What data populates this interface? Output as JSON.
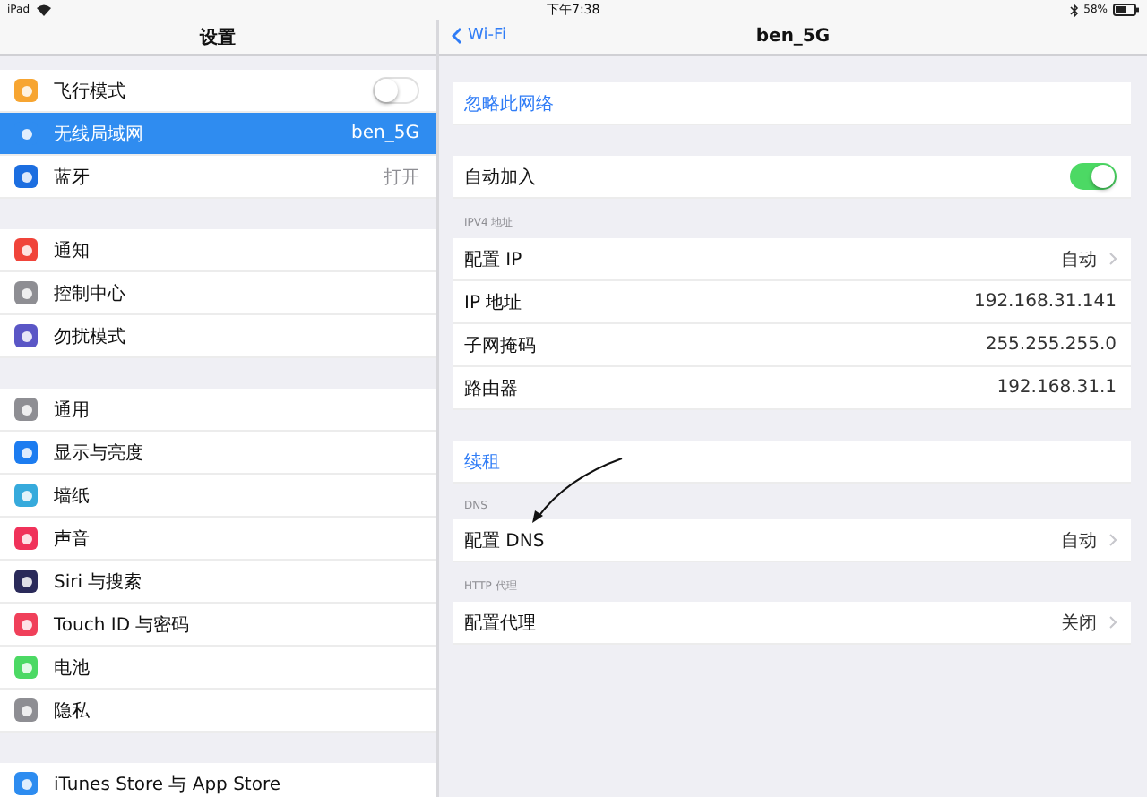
{
  "status_bar": {
    "device": "iPad",
    "time": "下午7:38",
    "battery": "58%"
  },
  "sidebar": {
    "title": "设置",
    "groups": [
      [
        {
          "label": "飞行模式",
          "kind": "toggle",
          "on": false,
          "selected": false,
          "color": "#f7a531"
        },
        {
          "label": "无线局域网",
          "kind": "value",
          "value": "ben_5G",
          "selected": true,
          "color": "#2f8cf0"
        },
        {
          "label": "蓝牙",
          "kind": "value",
          "value": "打开",
          "selected": false,
          "color": "#1c6ee0"
        }
      ],
      [
        {
          "label": "通知",
          "kind": "plain",
          "selected": false,
          "color": "#f0443a"
        },
        {
          "label": "控制中心",
          "kind": "plain",
          "selected": false,
          "color": "#8e8e93"
        },
        {
          "label": "勿扰模式",
          "kind": "plain",
          "selected": false,
          "color": "#5a56c6"
        }
      ],
      [
        {
          "label": "通用",
          "kind": "plain",
          "selected": false,
          "color": "#8e8e93"
        },
        {
          "label": "显示与亮度",
          "kind": "plain",
          "selected": false,
          "color": "#1c7cf0"
        },
        {
          "label": "墙纸",
          "kind": "plain",
          "selected": false,
          "color": "#36aadc"
        },
        {
          "label": "声音",
          "kind": "plain",
          "selected": false,
          "color": "#f0325a"
        },
        {
          "label": "Siri 与搜索",
          "kind": "plain",
          "selected": false,
          "color": "#2a2a5a"
        },
        {
          "label": "Touch ID 与密码",
          "kind": "plain",
          "selected": false,
          "color": "#f0405a"
        },
        {
          "label": "电池",
          "kind": "plain",
          "selected": false,
          "color": "#4cd964"
        },
        {
          "label": "隐私",
          "kind": "plain",
          "selected": false,
          "color": "#8e8e93"
        }
      ],
      [
        {
          "label": "iTunes Store 与 App Store",
          "kind": "plain",
          "selected": false,
          "color": "#2d8cf0"
        }
      ]
    ]
  },
  "detail": {
    "back": "Wi-Fi",
    "title": "ben_5G",
    "sections": [
      {
        "rows": [
          {
            "label": "忽略此网络",
            "kind": "link"
          }
        ]
      },
      {
        "rows": [
          {
            "label": "自动加入",
            "kind": "toggle",
            "on": true
          }
        ]
      },
      {
        "header": "IPV4 地址",
        "rows": [
          {
            "label": "配置 IP",
            "kind": "detail",
            "value": "自动"
          },
          {
            "label": "IP 地址",
            "kind": "info",
            "value": "192.168.31.141"
          },
          {
            "label": "子网掩码",
            "kind": "info",
            "value": "255.255.255.0"
          },
          {
            "label": "路由器",
            "kind": "info",
            "value": "192.168.31.1"
          }
        ]
      },
      {
        "rows": [
          {
            "label": "续租",
            "kind": "link"
          }
        ]
      },
      {
        "header": "DNS",
        "rows": [
          {
            "label": "配置 DNS",
            "kind": "detail",
            "value": "自动"
          }
        ]
      },
      {
        "header": "HTTP 代理",
        "rows": [
          {
            "label": "配置代理",
            "kind": "detail",
            "value": "关闭"
          }
        ]
      }
    ]
  }
}
